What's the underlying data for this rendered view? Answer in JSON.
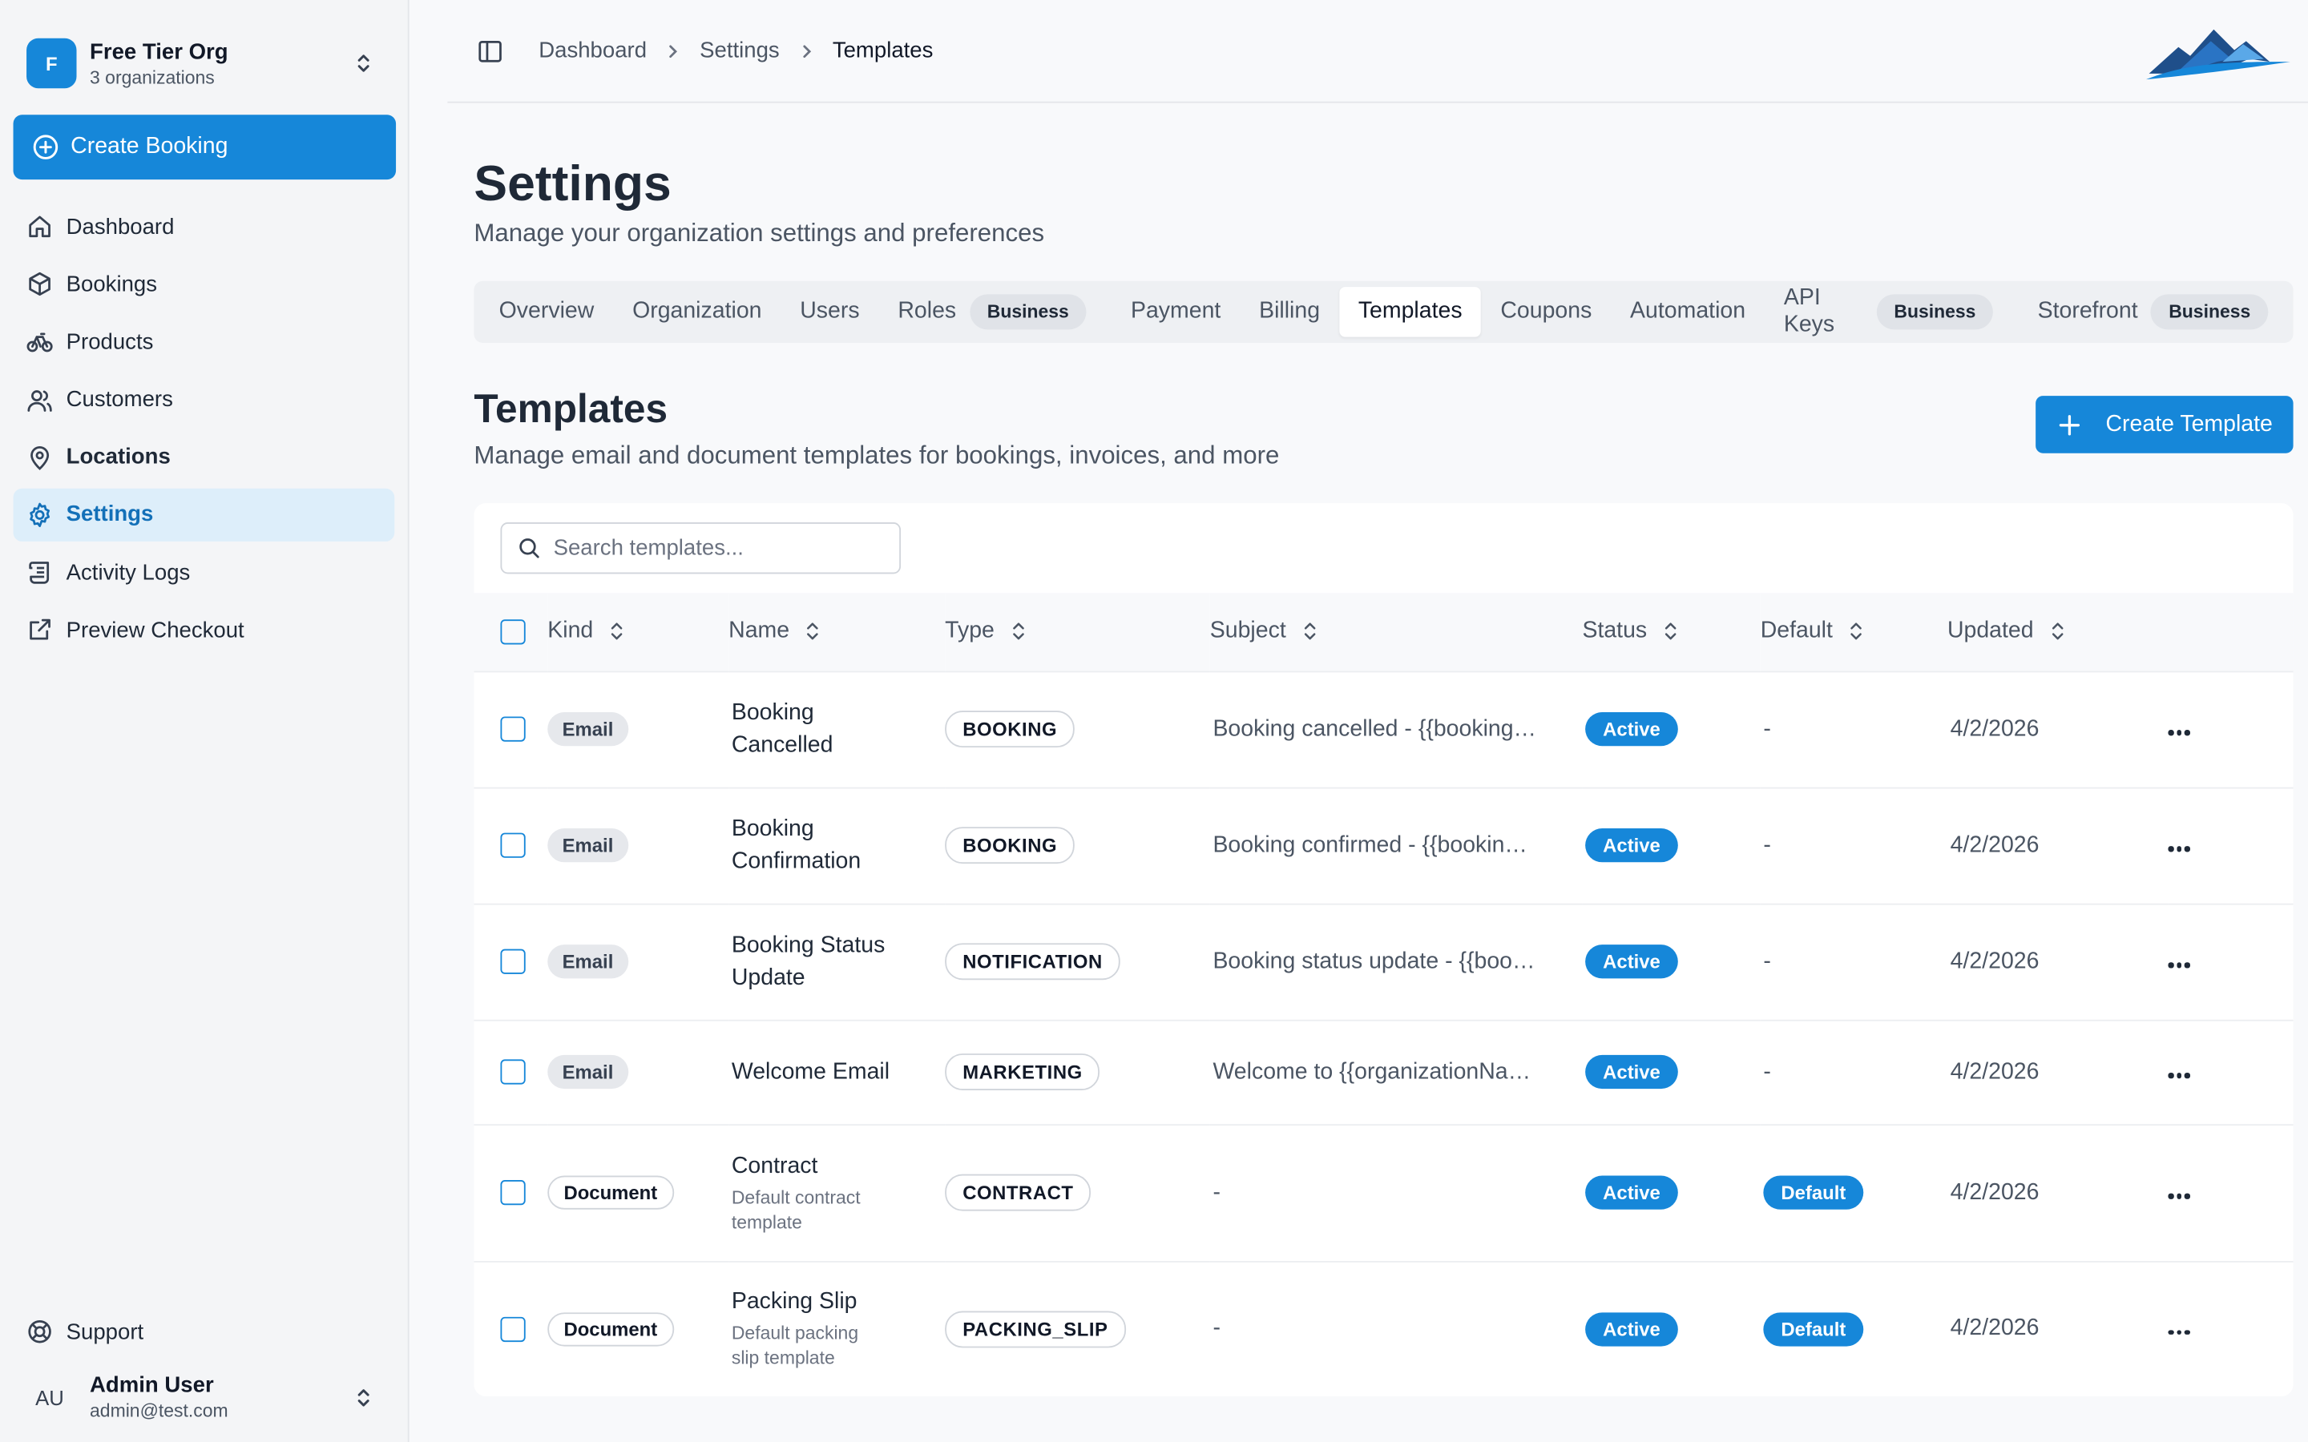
{
  "org": {
    "initial": "F",
    "name": "Free Tier Org",
    "sub": "3 organizations"
  },
  "sidebar": {
    "create_label": "Create Booking",
    "items": [
      {
        "label": "Dashboard",
        "icon": "home-icon"
      },
      {
        "label": "Bookings",
        "icon": "box-icon"
      },
      {
        "label": "Products",
        "icon": "bike-icon"
      },
      {
        "label": "Customers",
        "icon": "users-icon"
      },
      {
        "label": "Locations",
        "icon": "map-pin-icon"
      },
      {
        "label": "Settings",
        "icon": "gear-icon"
      },
      {
        "label": "Activity Logs",
        "icon": "scroll-icon"
      },
      {
        "label": "Preview Checkout",
        "icon": "external-link-icon"
      }
    ],
    "support_label": "Support",
    "user": {
      "initials": "AU",
      "name": "Admin User",
      "email": "admin@test.com"
    }
  },
  "breadcrumb": [
    "Dashboard",
    "Settings",
    "Templates"
  ],
  "page": {
    "title": "Settings",
    "subtitle": "Manage your organization settings and preferences"
  },
  "tabs": [
    {
      "label": "Overview"
    },
    {
      "label": "Organization"
    },
    {
      "label": "Users"
    },
    {
      "label": "Roles",
      "badge": "Business"
    },
    {
      "label": "Payment"
    },
    {
      "label": "Billing"
    },
    {
      "label": "Templates",
      "active": true
    },
    {
      "label": "Coupons"
    },
    {
      "label": "Automation"
    },
    {
      "label": "API Keys",
      "badge": "Business"
    },
    {
      "label": "Storefront",
      "badge": "Business"
    }
  ],
  "section": {
    "title": "Templates",
    "subtitle": "Manage email and document templates for bookings, invoices, and more",
    "create_label": "Create Template"
  },
  "search": {
    "placeholder": "Search templates...",
    "value": ""
  },
  "table": {
    "columns": [
      "Kind",
      "Name",
      "Type",
      "Subject",
      "Status",
      "Default",
      "Updated"
    ],
    "rows": [
      {
        "kind": "Email",
        "name": "Booking Cancelled",
        "desc": "",
        "type": "BOOKING",
        "subject": "Booking cancelled - {{booking…",
        "status": "Active",
        "default": "-",
        "updated": "4/2/2026"
      },
      {
        "kind": "Email",
        "name": "Booking Confirmation",
        "desc": "",
        "type": "BOOKING",
        "subject": "Booking confirmed - {{bookin…",
        "status": "Active",
        "default": "-",
        "updated": "4/2/2026"
      },
      {
        "kind": "Email",
        "name": "Booking Status Update",
        "desc": "",
        "type": "NOTIFICATION",
        "subject": "Booking status update - {{boo…",
        "status": "Active",
        "default": "-",
        "updated": "4/2/2026"
      },
      {
        "kind": "Email",
        "name": "Welcome Email",
        "desc": "",
        "type": "MARKETING",
        "subject": "Welcome to {{organizationNa…",
        "status": "Active",
        "default": "-",
        "updated": "4/2/2026"
      },
      {
        "kind": "Document",
        "name": "Contract",
        "desc": "Default contract template",
        "type": "CONTRACT",
        "subject": "-",
        "status": "Active",
        "default": "Default",
        "updated": "4/2/2026"
      },
      {
        "kind": "Document",
        "name": "Packing Slip",
        "desc": "Default packing slip template",
        "type": "PACKING_SLIP",
        "subject": "-",
        "status": "Active",
        "default": "Default",
        "updated": "4/2/2026"
      }
    ]
  },
  "colors": {
    "accent": "#1687d9",
    "active_nav_bg": "#ddeefa"
  }
}
